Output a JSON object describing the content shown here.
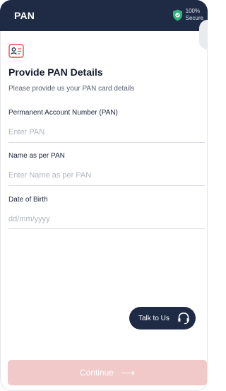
{
  "header": {
    "title": "PAN",
    "secure_line1": "100%",
    "secure_line2": "Secure"
  },
  "form": {
    "heading": "Provide PAN Details",
    "subheading": "Please provide us your PAN card details",
    "fields": [
      {
        "label": "Permanent Account Number (PAN)",
        "placeholder": "Enter PAN",
        "value": ""
      },
      {
        "label": "Name as per PAN",
        "placeholder": "Enter Name as per PAN",
        "value": ""
      },
      {
        "label": "Date of Birth",
        "placeholder": "dd/mm/yyyy",
        "value": ""
      }
    ]
  },
  "talk_button": {
    "label": "Talk to Us",
    "icon": "headset-icon"
  },
  "continue_button": {
    "label": "Continue",
    "icon": "arrow-right-icon",
    "state": "disabled"
  },
  "colors": {
    "header_bg": "#1f2b45",
    "secure_green": "#2fb67c",
    "accent_red": "#e04f4f",
    "continue_disabled_bg": "#f1c9c9"
  }
}
